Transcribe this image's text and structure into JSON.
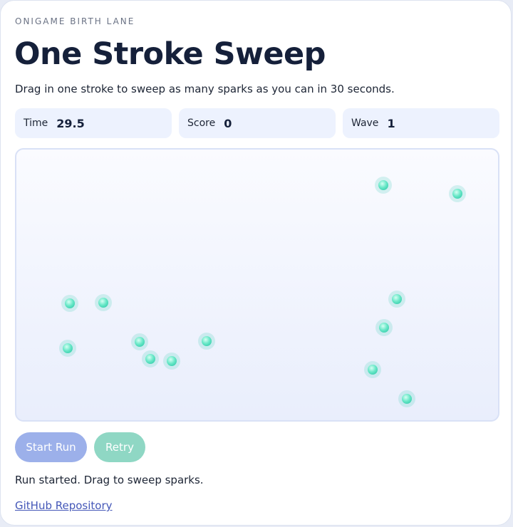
{
  "header": {
    "kicker": "ONIGAME BIRTH LANE",
    "title": "One Stroke Sweep",
    "subtitle": "Drag in one stroke to sweep as many sparks as you can in 30 seconds."
  },
  "stats": {
    "time": {
      "label": "Time",
      "value": "29.5"
    },
    "score": {
      "label": "Score",
      "value": "0"
    },
    "wave": {
      "label": "Wave",
      "value": "1"
    }
  },
  "sparks_count": 13,
  "buttons": {
    "start_label": "Start Run",
    "retry_label": "Retry"
  },
  "status_text": "Run started. Drag to sweep sparks.",
  "footer": {
    "repo_link": "GitHub Repository"
  },
  "colors": {
    "title": "#15203a",
    "stat_background": "#edf2fe",
    "spark": "#5fe3c2",
    "start_button": "#9cb0ea",
    "retry_button": "#8fd7c4",
    "link": "#4457b8"
  },
  "icons": {
    "spark": "glowing-orb"
  }
}
